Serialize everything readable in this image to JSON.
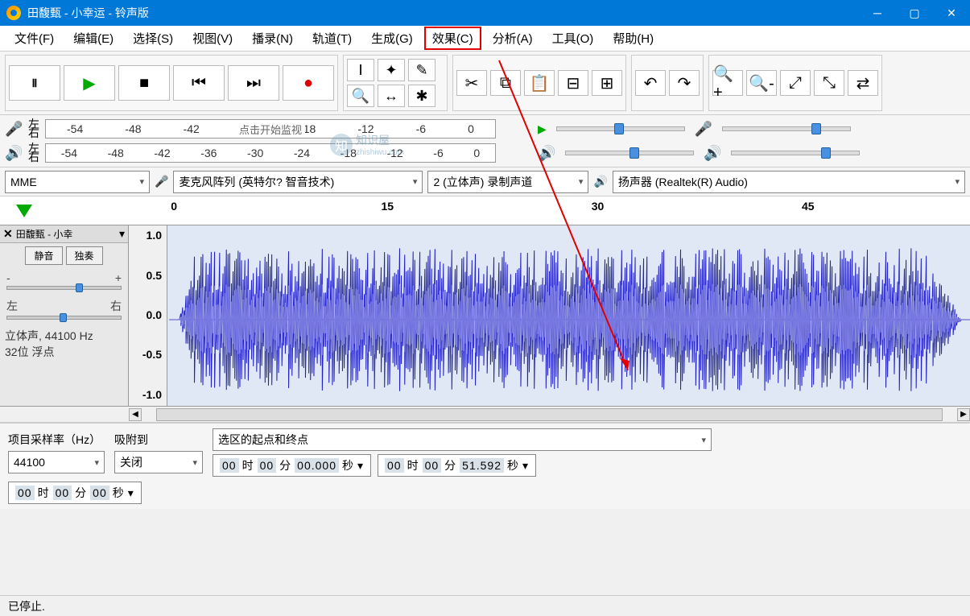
{
  "window": {
    "title": "田馥甄 - 小幸运 - 铃声版"
  },
  "menu": {
    "file": "文件(F)",
    "edit": "编辑(E)",
    "select": "选择(S)",
    "view": "视图(V)",
    "transport": "播录(N)",
    "tracks": "轨道(T)",
    "generate": "生成(G)",
    "effect": "效果(C)",
    "analyze": "分析(A)",
    "tools": "工具(O)",
    "help": "帮助(H)"
  },
  "meters": {
    "L": "左",
    "R": "右",
    "ticks": [
      "-54",
      "-48",
      "-42",
      "-36",
      "-30",
      "-24",
      "-18",
      "-12",
      "-6",
      "0"
    ],
    "rec_hint": "点击开始监视"
  },
  "devices": {
    "host": "MME",
    "rec": "麦克风阵列 (英特尔? 智音技术)",
    "channels": "2 (立体声) 录制声道",
    "play": "扬声器 (Realtek(R) Audio)"
  },
  "timeline": {
    "ticks": [
      "0",
      "15",
      "30",
      "45"
    ]
  },
  "track": {
    "name": "田馥甄 - 小幸",
    "mute": "静音",
    "solo": "独奏",
    "gain_l": "-",
    "gain_r": "+",
    "pan_l": "左",
    "pan_r": "右",
    "info1": "立体声, 44100 Hz",
    "info2": "32位 浮点",
    "yaxis": [
      "1.0",
      "0.5",
      "0.0",
      "-0.5",
      "-1.0"
    ]
  },
  "selection": {
    "rate_label": "项目采样率（Hz）",
    "rate": "44100",
    "snap_label": "吸附到",
    "snap": "关闭",
    "range_label": "选区的起点和终点",
    "start": {
      "h": "00",
      "hl": "时",
      "m": "00",
      "ml": "分",
      "s": "00.000",
      "sl": "秒"
    },
    "end": {
      "h": "00",
      "hl": "时",
      "m": "00",
      "ml": "分",
      "s": "51.592",
      "sl": "秒"
    },
    "pos": {
      "h": "00",
      "hl": "时",
      "m": "00",
      "ml": "分",
      "s": "00",
      "sl": "秒"
    }
  },
  "status": "已停止.",
  "watermark": {
    "name": "知识屋",
    "url": "zhishiwu.com"
  }
}
